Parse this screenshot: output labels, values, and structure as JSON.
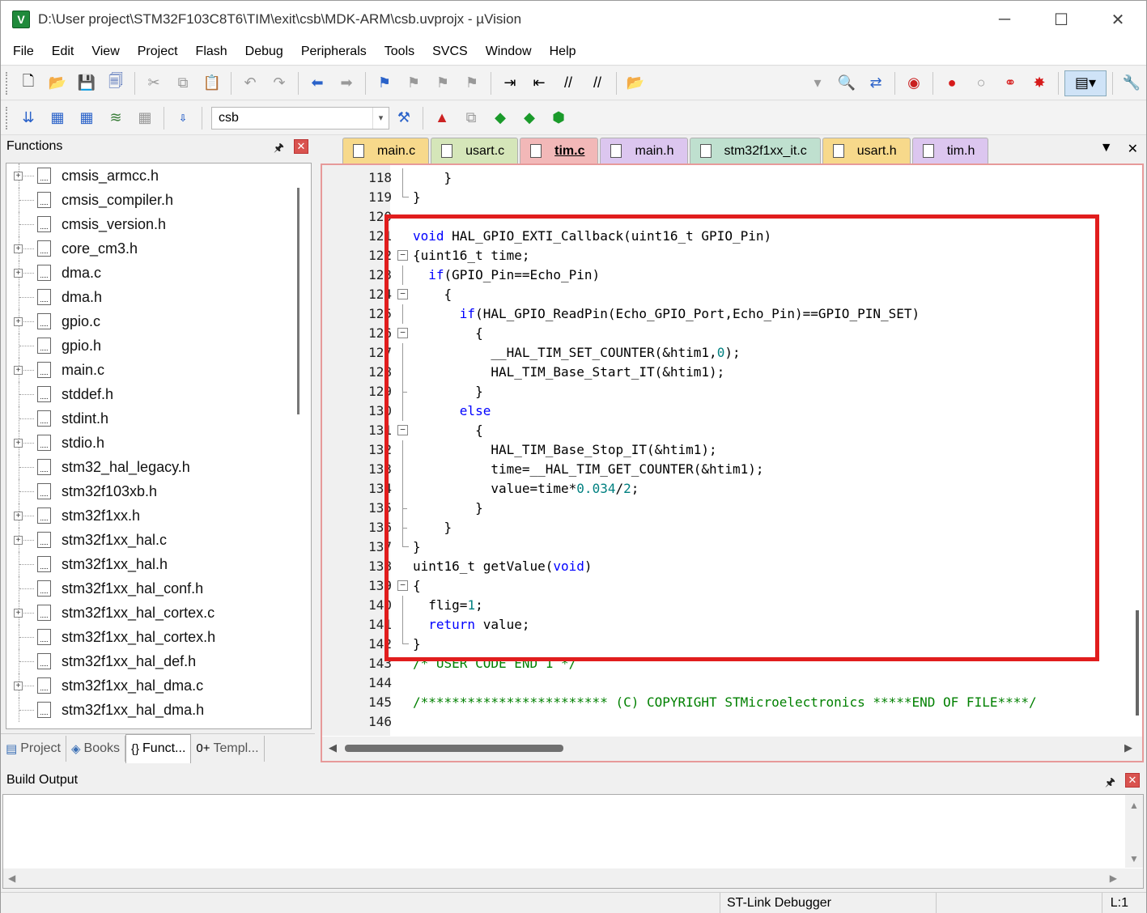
{
  "window": {
    "title": "D:\\User project\\STM32F103C8T6\\TIM\\exit\\csb\\MDK-ARM\\csb.uvprojx - µVision",
    "app_icon": "V",
    "controls": [
      "─",
      "☐",
      "✕"
    ]
  },
  "menu": [
    "File",
    "Edit",
    "View",
    "Project",
    "Flash",
    "Debug",
    "Peripherals",
    "Tools",
    "SVCS",
    "Window",
    "Help"
  ],
  "toolbar": {
    "target": "csb",
    "target_dropdown": "▾"
  },
  "functions_panel": {
    "title": "Functions",
    "pin": "📌",
    "close": "✕",
    "items": [
      {
        "label": "cmsis_armcc.h",
        "expandable": true
      },
      {
        "label": "cmsis_compiler.h",
        "expandable": false
      },
      {
        "label": "cmsis_version.h",
        "expandable": false
      },
      {
        "label": "core_cm3.h",
        "expandable": true
      },
      {
        "label": "dma.c",
        "expandable": true
      },
      {
        "label": "dma.h",
        "expandable": false
      },
      {
        "label": "gpio.c",
        "expandable": true
      },
      {
        "label": "gpio.h",
        "expandable": false
      },
      {
        "label": "main.c",
        "expandable": true
      },
      {
        "label": "stddef.h",
        "expandable": false
      },
      {
        "label": "stdint.h",
        "expandable": false
      },
      {
        "label": "stdio.h",
        "expandable": true
      },
      {
        "label": "stm32_hal_legacy.h",
        "expandable": false
      },
      {
        "label": "stm32f103xb.h",
        "expandable": false
      },
      {
        "label": "stm32f1xx.h",
        "expandable": true
      },
      {
        "label": "stm32f1xx_hal.c",
        "expandable": true
      },
      {
        "label": "stm32f1xx_hal.h",
        "expandable": false
      },
      {
        "label": "stm32f1xx_hal_conf.h",
        "expandable": false
      },
      {
        "label": "stm32f1xx_hal_cortex.c",
        "expandable": true
      },
      {
        "label": "stm32f1xx_hal_cortex.h",
        "expandable": false
      },
      {
        "label": "stm32f1xx_hal_def.h",
        "expandable": false
      },
      {
        "label": "stm32f1xx_hal_dma.c",
        "expandable": true
      },
      {
        "label": "stm32f1xx_hal_dma.h",
        "expandable": false
      }
    ],
    "bottom_tabs": [
      {
        "icon": "▤",
        "label": "Project"
      },
      {
        "icon": "◈",
        "label": "Books"
      },
      {
        "icon": "{}",
        "label": "Funct..."
      },
      {
        "icon": "0+",
        "label": "Templ..."
      }
    ]
  },
  "editor": {
    "tabs": [
      {
        "label": "main.c",
        "color": "#f7d98b"
      },
      {
        "label": "usart.c",
        "color": "#d5e6b9"
      },
      {
        "label": "tim.c",
        "color": "#f2b8b8",
        "active": true
      },
      {
        "label": "main.h",
        "color": "#dcc6ef"
      },
      {
        "label": "stm32f1xx_it.c",
        "color": "#bfe0cf"
      },
      {
        "label": "usart.h",
        "color": "#f7d98b"
      },
      {
        "label": "tim.h",
        "color": "#dcc6ef"
      }
    ],
    "tab_menu": "▼",
    "tab_close": "✕",
    "lines": [
      {
        "n": "118",
        "fold": "line",
        "code": "    }"
      },
      {
        "n": "119",
        "fold": "end",
        "code": "}"
      },
      {
        "n": "120",
        "fold": "none",
        "code": ""
      },
      {
        "n": "121",
        "fold": "none",
        "code": "void HAL_GPIO_EXTI_Callback(uint16_t GPIO_Pin)"
      },
      {
        "n": "122",
        "fold": "box",
        "code": "{uint16_t time;"
      },
      {
        "n": "123",
        "fold": "line",
        "code": "  if(GPIO_Pin==Echo_Pin)"
      },
      {
        "n": "124",
        "fold": "box",
        "code": "    {"
      },
      {
        "n": "125",
        "fold": "line",
        "code": "      if(HAL_GPIO_ReadPin(Echo_GPIO_Port,Echo_Pin)==GPIO_PIN_SET)"
      },
      {
        "n": "126",
        "fold": "box",
        "code": "        {"
      },
      {
        "n": "127",
        "fold": "line",
        "code": "          __HAL_TIM_SET_COUNTER(&htim1,0);"
      },
      {
        "n": "128",
        "fold": "line",
        "code": "          HAL_TIM_Base_Start_IT(&htim1);"
      },
      {
        "n": "129",
        "fold": "tick",
        "code": "        }"
      },
      {
        "n": "130",
        "fold": "line",
        "code": "      else"
      },
      {
        "n": "131",
        "fold": "box",
        "code": "        {"
      },
      {
        "n": "132",
        "fold": "line",
        "code": "          HAL_TIM_Base_Stop_IT(&htim1);"
      },
      {
        "n": "133",
        "fold": "line",
        "code": "          time=__HAL_TIM_GET_COUNTER(&htim1);"
      },
      {
        "n": "134",
        "fold": "line",
        "code": "          value=time*0.034/2;"
      },
      {
        "n": "135",
        "fold": "tick",
        "code": "        }"
      },
      {
        "n": "136",
        "fold": "tick",
        "code": "    }"
      },
      {
        "n": "137",
        "fold": "end",
        "code": "}"
      },
      {
        "n": "138",
        "fold": "none",
        "code": "uint16_t getValue(void)"
      },
      {
        "n": "139",
        "fold": "box",
        "code": "{"
      },
      {
        "n": "140",
        "fold": "line",
        "code": "  flig=1;"
      },
      {
        "n": "141",
        "fold": "line",
        "code": "  return value;"
      },
      {
        "n": "142",
        "fold": "end",
        "code": "}"
      },
      {
        "n": "143",
        "fold": "none",
        "code": "/* USER CODE END 1 */"
      },
      {
        "n": "144",
        "fold": "none",
        "code": ""
      },
      {
        "n": "145",
        "fold": "none",
        "code": "/************************ (C) COPYRIGHT STMicroelectronics *****END OF FILE****/"
      },
      {
        "n": "146",
        "fold": "none",
        "code": ""
      }
    ],
    "highlight_color": "#e11d1d"
  },
  "build_output": {
    "title": "Build Output",
    "pin": "📌",
    "close": "✕"
  },
  "statusbar": {
    "debugger": "ST-Link Debugger",
    "position": "L:1"
  }
}
